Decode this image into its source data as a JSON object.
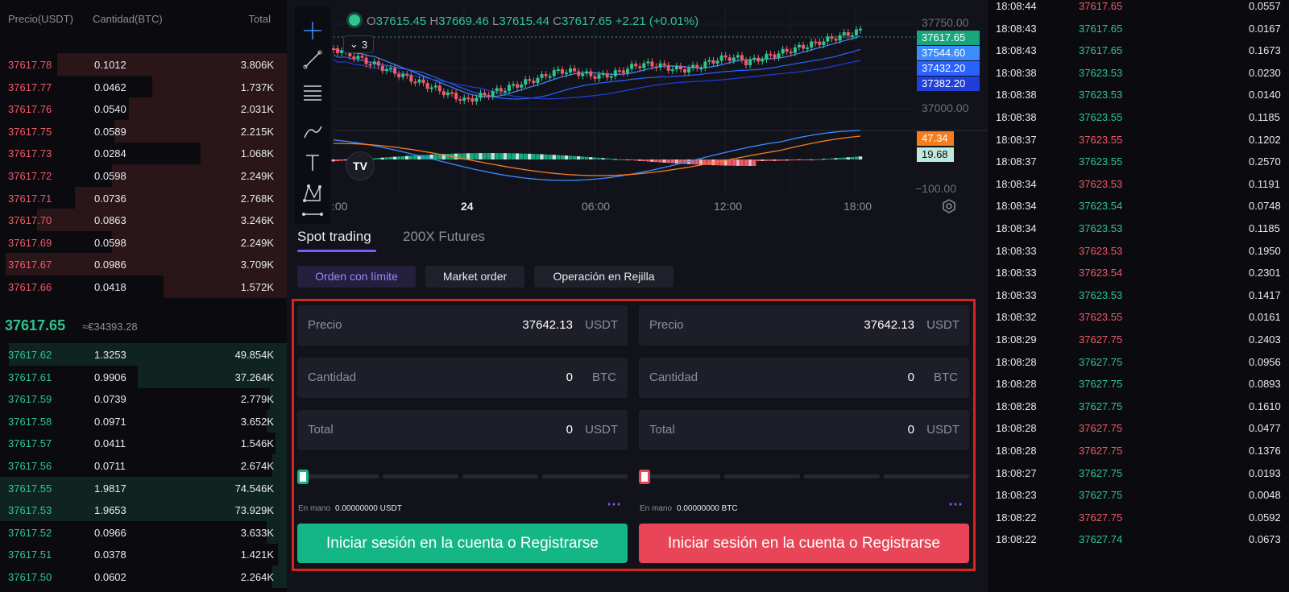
{
  "orderbook": {
    "headers": {
      "price": "Precio(USDT)",
      "qty": "Cantidad(BTC)",
      "total": "Total"
    },
    "asks": [
      {
        "price": "37617.78",
        "qty": "0.1012",
        "total": "3.806K",
        "depth": 0.8
      },
      {
        "price": "37617.77",
        "qty": "0.0462",
        "total": "1.737K",
        "depth": 0.47
      },
      {
        "price": "37617.76",
        "qty": "0.0540",
        "total": "2.031K",
        "depth": 0.55
      },
      {
        "price": "37617.75",
        "qty": "0.0589",
        "total": "2.215K",
        "depth": 0.6
      },
      {
        "price": "37617.73",
        "qty": "0.0284",
        "total": "1.068K",
        "depth": 0.3
      },
      {
        "price": "37617.72",
        "qty": "0.0598",
        "total": "2.249K",
        "depth": 0.61
      },
      {
        "price": "37617.71",
        "qty": "0.0736",
        "total": "2.768K",
        "depth": 0.74
      },
      {
        "price": "37617.70",
        "qty": "0.0863",
        "total": "3.246K",
        "depth": 0.87
      },
      {
        "price": "37617.69",
        "qty": "0.0598",
        "total": "2.249K",
        "depth": 0.61
      },
      {
        "price": "37617.67",
        "qty": "0.0986",
        "total": "3.709K",
        "depth": 0.98
      },
      {
        "price": "37617.66",
        "qty": "0.0418",
        "total": "1.572K",
        "depth": 0.43
      }
    ],
    "last_price": "37617.65",
    "last_price_eur": "≈€34393.28",
    "bids": [
      {
        "price": "37617.62",
        "qty": "1.3253",
        "total": "49.854K",
        "depth": 0.97
      },
      {
        "price": "37617.61",
        "qty": "0.9906",
        "total": "37.264K",
        "depth": 0.52
      },
      {
        "price": "37617.59",
        "qty": "0.0739",
        "total": "2.779K",
        "depth": 0.06
      },
      {
        "price": "37617.58",
        "qty": "0.0971",
        "total": "3.652K",
        "depth": 0.07
      },
      {
        "price": "37617.57",
        "qty": "0.0411",
        "total": "1.546K",
        "depth": 0.04
      },
      {
        "price": "37617.56",
        "qty": "0.0711",
        "total": "2.674K",
        "depth": 0.05
      },
      {
        "price": "37617.55",
        "qty": "1.9817",
        "total": "74.546K",
        "depth": 1.0
      },
      {
        "price": "37617.53",
        "qty": "1.9653",
        "total": "73.929K",
        "depth": 1.0
      },
      {
        "price": "37617.52",
        "qty": "0.0966",
        "total": "3.633K",
        "depth": 0.07
      },
      {
        "price": "37617.51",
        "qty": "0.0378",
        "total": "1.421K",
        "depth": 0.03
      },
      {
        "price": "37617.50",
        "qty": "0.0602",
        "total": "2.264K",
        "depth": 0.05
      }
    ]
  },
  "chart": {
    "ohlc": {
      "o_label": "O",
      "o": "37615.45",
      "h_label": "H",
      "h": "37669.46",
      "l_label": "L",
      "l": "37615.44",
      "c_label": "C",
      "c": "37617.65",
      "change": "+2.21 (+0.01%)"
    },
    "indicator_count": "3",
    "price_axis": [
      "37750.00",
      "37000.00"
    ],
    "price_tags": [
      {
        "value": "37617.65",
        "color": "#16a77c"
      },
      {
        "value": "37544.60",
        "color": "#3d8bff"
      },
      {
        "value": "37432.20",
        "color": "#2962ff"
      },
      {
        "value": "37382.20",
        "color": "#1f3fd8"
      }
    ],
    "osc_tags": [
      {
        "value": "47.34",
        "color": "#f57c1f"
      },
      {
        "value": "19.68",
        "color": "#bfe9dc"
      }
    ],
    "osc_axis": "−100.00",
    "time_axis": [
      ":00",
      "24",
      "06:00",
      "12:00",
      "18:00"
    ],
    "logo_text": "TV"
  },
  "trading": {
    "tabs": [
      "Spot trading",
      "200X Futures"
    ],
    "order_types": [
      "Orden con límite",
      "Market order",
      "Operación en Rejilla"
    ],
    "buy": {
      "price_label": "Precio",
      "price_value": "37642.13",
      "price_unit": "USDT",
      "qty_label": "Cantidad",
      "qty_value": "0",
      "qty_unit": "BTC",
      "total_label": "Total",
      "total_value": "0",
      "total_unit": "USDT",
      "slider_value": 0,
      "balance_label": "En mano",
      "balance_value": "0.00000000 USDT",
      "button": "Iniciar sesión en la cuenta o Registrarse"
    },
    "sell": {
      "price_label": "Precio",
      "price_value": "37642.13",
      "price_unit": "USDT",
      "qty_label": "Cantidad",
      "qty_value": "0",
      "qty_unit": "BTC",
      "total_label": "Total",
      "total_value": "0",
      "total_unit": "USDT",
      "slider_value": 0,
      "balance_label": "En mano",
      "balance_value": "0.00000000 BTC",
      "button": "Iniciar sesión en la cuenta o Registrarse"
    },
    "more_icon": "⋯"
  },
  "trades": [
    {
      "time": "18:08:44",
      "price": "37617.65",
      "qty": "0.0557",
      "side": "down"
    },
    {
      "time": "18:08:43",
      "price": "37617.65",
      "qty": "0.0167",
      "side": "up"
    },
    {
      "time": "18:08:43",
      "price": "37617.65",
      "qty": "0.1673",
      "side": "up"
    },
    {
      "time": "18:08:38",
      "price": "37623.53",
      "qty": "0.0230",
      "side": "up"
    },
    {
      "time": "18:08:38",
      "price": "37623.53",
      "qty": "0.0140",
      "side": "up"
    },
    {
      "time": "18:08:38",
      "price": "37623.55",
      "qty": "0.1185",
      "side": "up"
    },
    {
      "time": "18:08:37",
      "price": "37623.55",
      "qty": "0.1202",
      "side": "down"
    },
    {
      "time": "18:08:37",
      "price": "37623.55",
      "qty": "0.2570",
      "side": "up"
    },
    {
      "time": "18:08:34",
      "price": "37623.53",
      "qty": "0.1191",
      "side": "down"
    },
    {
      "time": "18:08:34",
      "price": "37623.54",
      "qty": "0.0748",
      "side": "up"
    },
    {
      "time": "18:08:34",
      "price": "37623.53",
      "qty": "0.1185",
      "side": "up"
    },
    {
      "time": "18:08:33",
      "price": "37623.53",
      "qty": "0.1950",
      "side": "down"
    },
    {
      "time": "18:08:33",
      "price": "37623.54",
      "qty": "0.2301",
      "side": "down"
    },
    {
      "time": "18:08:33",
      "price": "37623.53",
      "qty": "0.1417",
      "side": "up"
    },
    {
      "time": "18:08:32",
      "price": "37623.55",
      "qty": "0.0161",
      "side": "down"
    },
    {
      "time": "18:08:29",
      "price": "37627.75",
      "qty": "0.2403",
      "side": "down"
    },
    {
      "time": "18:08:28",
      "price": "37627.75",
      "qty": "0.0956",
      "side": "up"
    },
    {
      "time": "18:08:28",
      "price": "37627.75",
      "qty": "0.0893",
      "side": "up"
    },
    {
      "time": "18:08:28",
      "price": "37627.75",
      "qty": "0.1610",
      "side": "up"
    },
    {
      "time": "18:08:28",
      "price": "37627.75",
      "qty": "0.0477",
      "side": "down"
    },
    {
      "time": "18:08:28",
      "price": "37627.75",
      "qty": "0.1376",
      "side": "down"
    },
    {
      "time": "18:08:27",
      "price": "37627.75",
      "qty": "0.0193",
      "side": "up"
    },
    {
      "time": "18:08:23",
      "price": "37627.75",
      "qty": "0.0048",
      "side": "up"
    },
    {
      "time": "18:08:22",
      "price": "37627.75",
      "qty": "0.0592",
      "side": "down"
    },
    {
      "time": "18:08:22",
      "price": "37627.74",
      "qty": "0.0673",
      "side": "up"
    }
  ]
}
